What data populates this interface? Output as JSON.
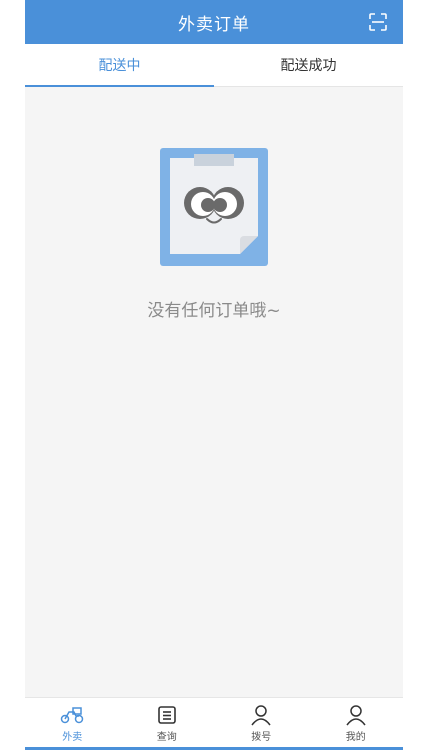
{
  "header": {
    "title": "外卖订单",
    "scan_icon": "scan-icon"
  },
  "tabs": [
    {
      "label": "配送中",
      "active": true
    },
    {
      "label": "配送成功",
      "active": false
    }
  ],
  "empty_state": {
    "message": "没有任何订单哦~",
    "icon": "clipboard-face-icon"
  },
  "bottom_nav": [
    {
      "label": "外卖",
      "icon": "scooter-icon",
      "active": true
    },
    {
      "label": "查询",
      "icon": "query-icon",
      "active": false
    },
    {
      "label": "拨号",
      "icon": "user-icon",
      "active": false
    },
    {
      "label": "我的",
      "icon": "user-icon",
      "active": false
    }
  ],
  "colors": {
    "accent": "#4a90d9",
    "background": "#f5f5f5"
  }
}
